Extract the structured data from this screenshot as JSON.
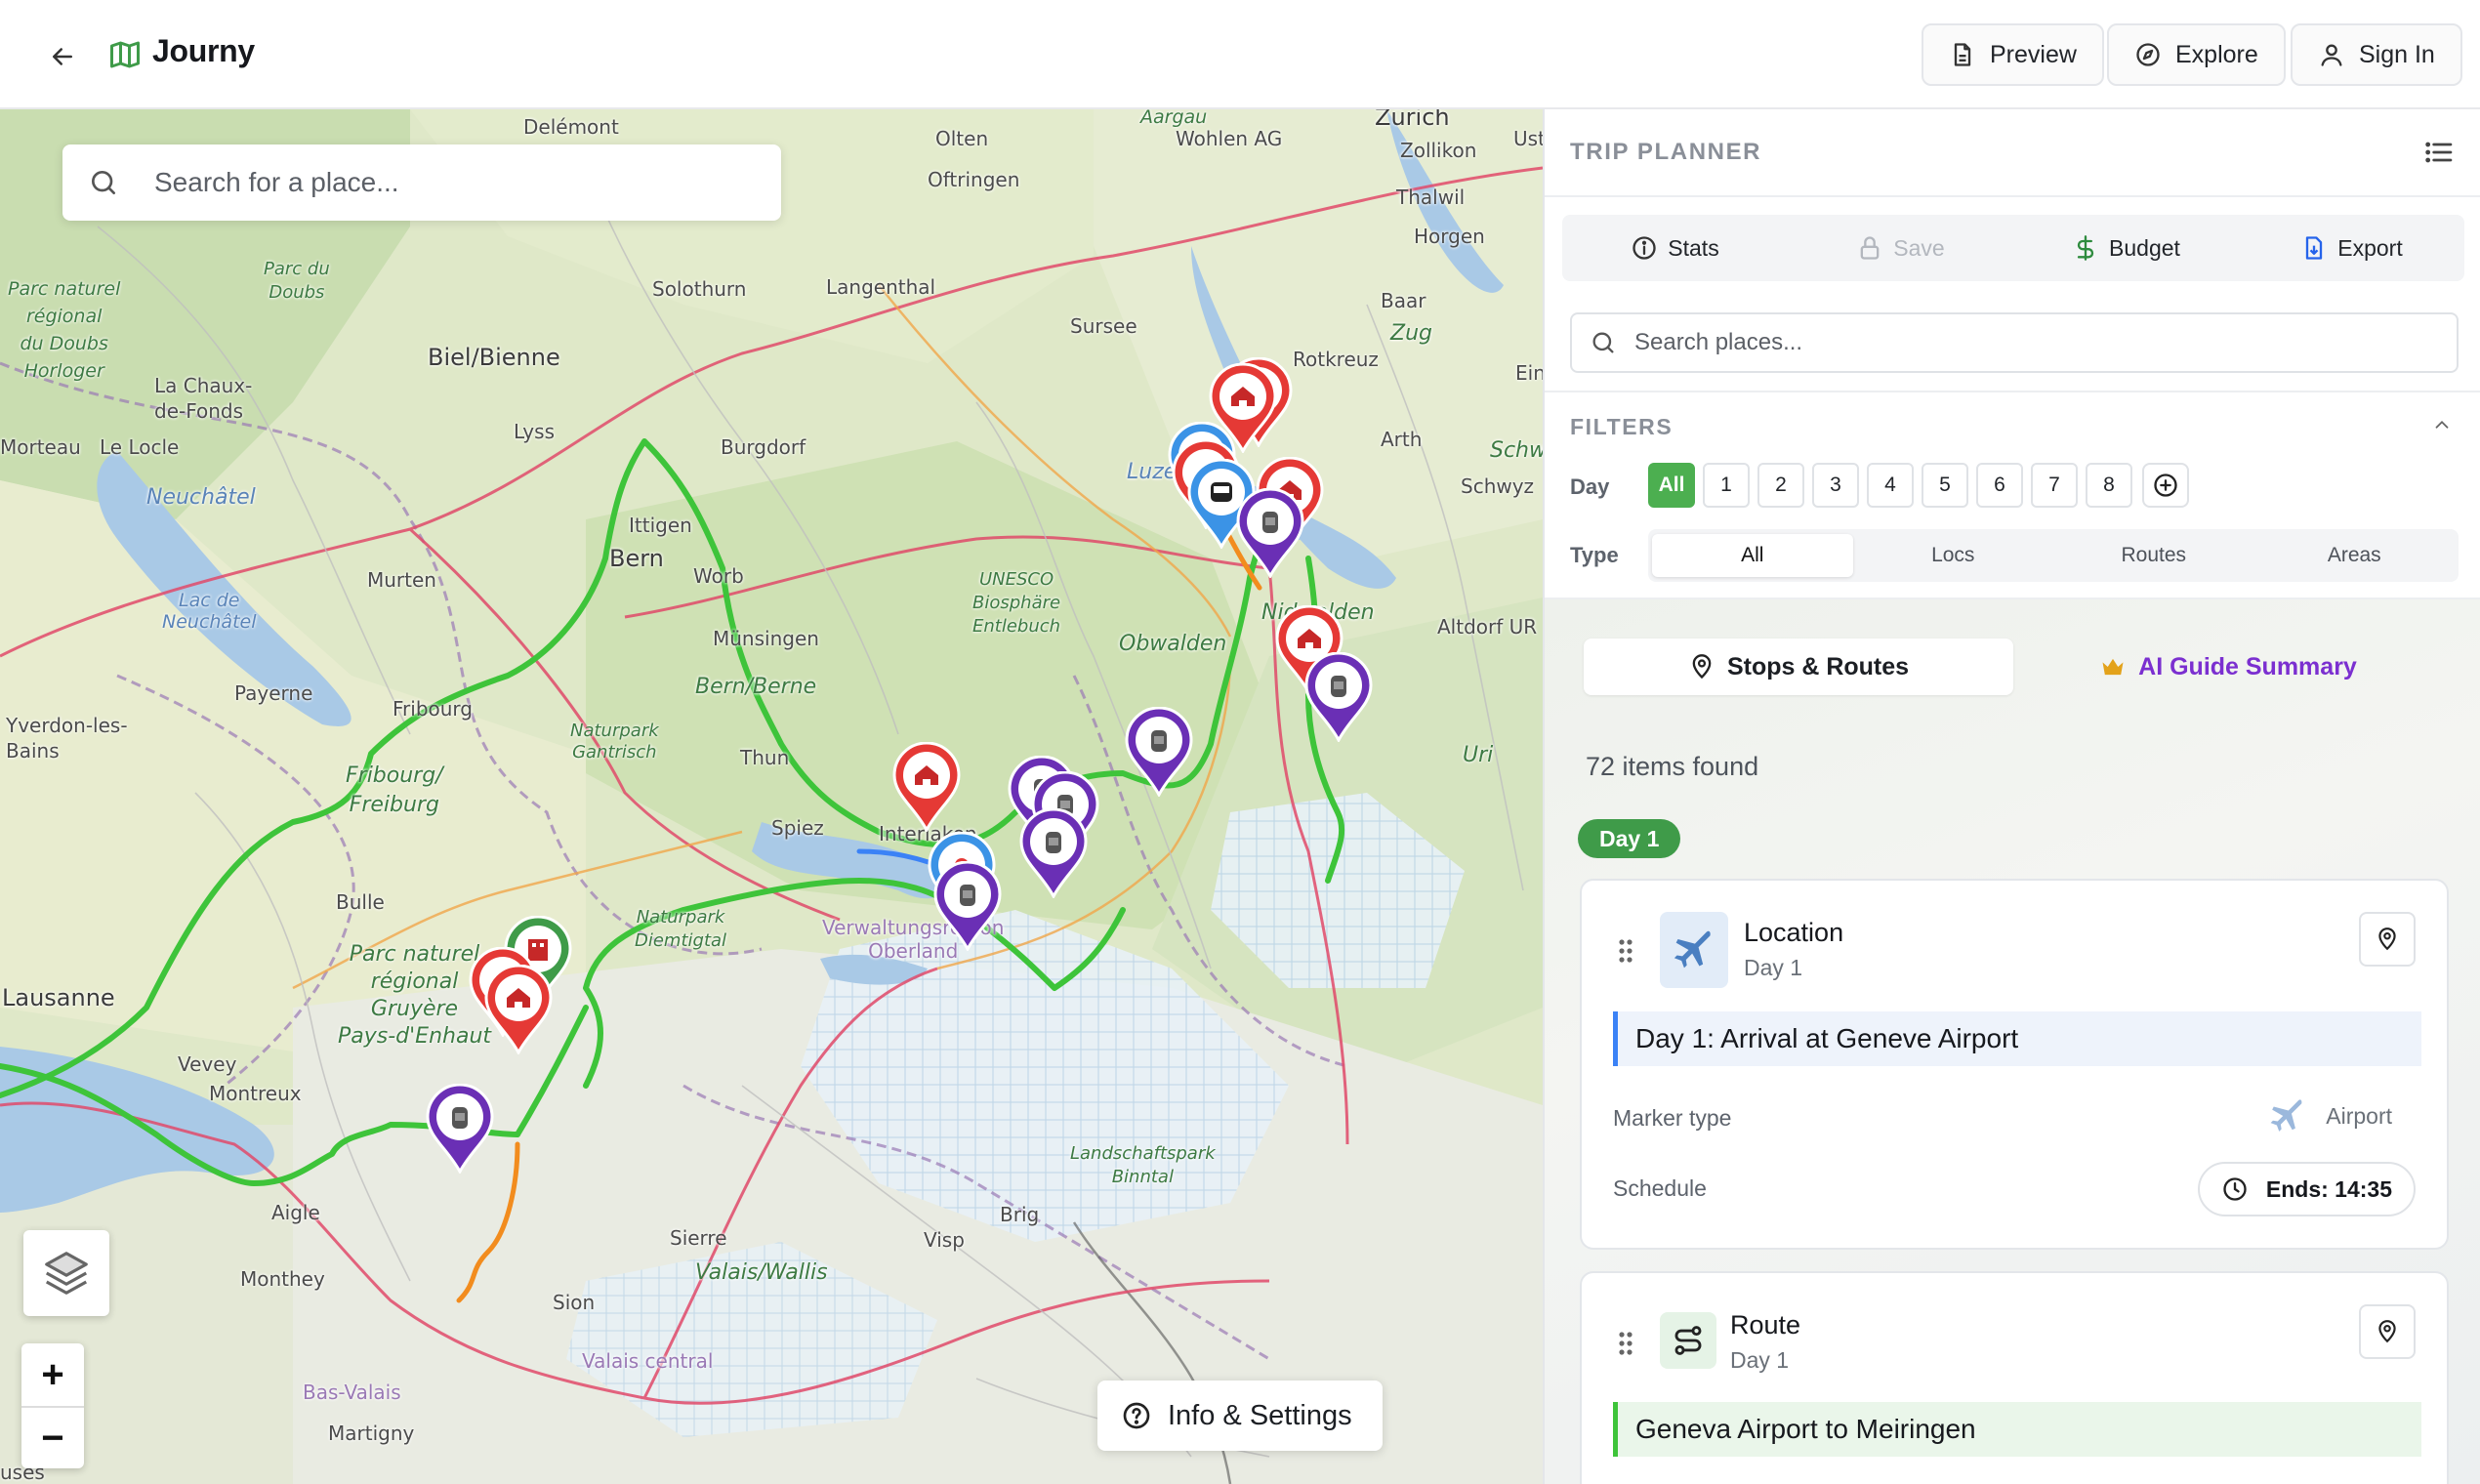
{
  "header": {
    "brand": "Journy",
    "preview_label": "Preview",
    "explore_label": "Explore",
    "signin_label": "Sign In"
  },
  "map": {
    "search_placeholder": "Search for a place...",
    "info_label": "Info & Settings",
    "zoom_in": "+",
    "zoom_out": "−",
    "labels": {
      "delemont": "Delémont",
      "olten": "Olten",
      "oftringen": "Oftringen",
      "aargau": "Aargau",
      "wohlen": "Wohlen AG",
      "zurich": "Zürich",
      "zollikon": "Zollikon",
      "thalwil": "Thalwil",
      "horgen": "Horgen",
      "ust": "Ust",
      "parc_doubs_1": "Parc naturel",
      "parc_doubs_2": "régional",
      "parc_doubs_3": "du Doubs",
      "parc_doubs_4": "Horloger",
      "parc_du": "Parc du",
      "doubs": "Doubs",
      "solothurn": "Solothurn",
      "langenthal": "Langenthal",
      "sursee": "Sursee",
      "baar": "Baar",
      "zug": "Zug",
      "biel": "Biel/Bienne",
      "lachaux1": "La Chaux-",
      "lachaux2": "de-Fonds",
      "rotkreuz": "Rotkreuz",
      "ein": "Ein",
      "morteau": "Morteau",
      "lelocle": "Le Locle",
      "lyss": "Lyss",
      "burgdorf": "Burgdorf",
      "arth": "Arth",
      "luzern": "Luze",
      "schw": "Schw",
      "schwyz": "Schwyz",
      "neuchatel": "Neuchâtel",
      "ittigen": "Ittigen",
      "bern": "Bern",
      "worb": "Worb",
      "lac1": "Lac de",
      "lac2": "Neuchâtel",
      "murten": "Murten",
      "unesco1": "UNESCO",
      "unesco2": "Biosphäre",
      "unesco3": "Entlebuch",
      "munsingen": "Münsingen",
      "obwalden": "Obwalden",
      "nidwalden": "Nidwalden",
      "altdorf": "Altdorf UR",
      "payerne": "Payerne",
      "bernberne": "Bern/Berne",
      "yverdon1": "Yverdon-les-",
      "yverdon2": "Bains",
      "fribourg": "Fribourg",
      "gantrisch1": "Naturpark",
      "gantrisch2": "Gantrisch",
      "frib1": "Fribourg/",
      "frib2": "Freiburg",
      "thun": "Thun",
      "uri": "Uri",
      "spiez": "Spiez",
      "interlaken": "Interlaken",
      "bulle": "Bulle",
      "diem1": "Naturpark",
      "diem2": "Diemtigtal",
      "verw1": "Verwaltungsregion",
      "verw2": "Oberland",
      "gruyere1": "Parc naturel",
      "gruyere2": "régional",
      "gruyere3": "Gruyère",
      "gruyere4": "Pays-d'Enhaut",
      "lausanne": "Lausanne",
      "vevey": "Vevey",
      "montreux": "Montreux",
      "binntal1": "Landschaftspark",
      "binntal2": "Binntal",
      "aigle": "Aigle",
      "brig": "Brig",
      "sierre": "Sierre",
      "visp": "Visp",
      "valais": "Valais/Wallis",
      "monthey": "Monthey",
      "sion": "Sion",
      "valaiscentral": "Valais central",
      "basvalais": "Bas-Valais",
      "martigny": "Martigny",
      "uses": "uses"
    }
  },
  "panel": {
    "title": "TRIP PLANNER",
    "tools": {
      "stats": "Stats",
      "save": "Save",
      "budget": "Budget",
      "export": "Export"
    },
    "search_placeholder": "Search places...",
    "filters": {
      "title": "FILTERS",
      "day_label": "Day",
      "days": [
        "All",
        "1",
        "2",
        "3",
        "4",
        "5",
        "6",
        "7",
        "8"
      ],
      "type_label": "Type",
      "types": [
        "All",
        "Locs",
        "Routes",
        "Areas"
      ]
    },
    "tabs": {
      "stops": "Stops & Routes",
      "ai": "AI Guide Summary"
    },
    "items_found": "72 items found",
    "day_pill": "Day 1",
    "card1": {
      "title": "Location",
      "sub": "Day 1",
      "banner": "Day 1: Arrival at Geneve Airport",
      "marker_label": "Marker type",
      "marker_value": "Airport",
      "schedule_label": "Schedule",
      "schedule_value": "Ends: 14:35"
    },
    "card2": {
      "title": "Route",
      "sub": "Day 1",
      "banner": "Geneva Airport to Meiringen"
    }
  },
  "colors": {
    "accent_green": "#4caf50",
    "route_green": "#3ec43a",
    "pin_red": "#e53935",
    "pin_purple": "#6a2fb5",
    "pin_blue": "#3b93e6",
    "ai_purple": "#7b2fd0"
  }
}
